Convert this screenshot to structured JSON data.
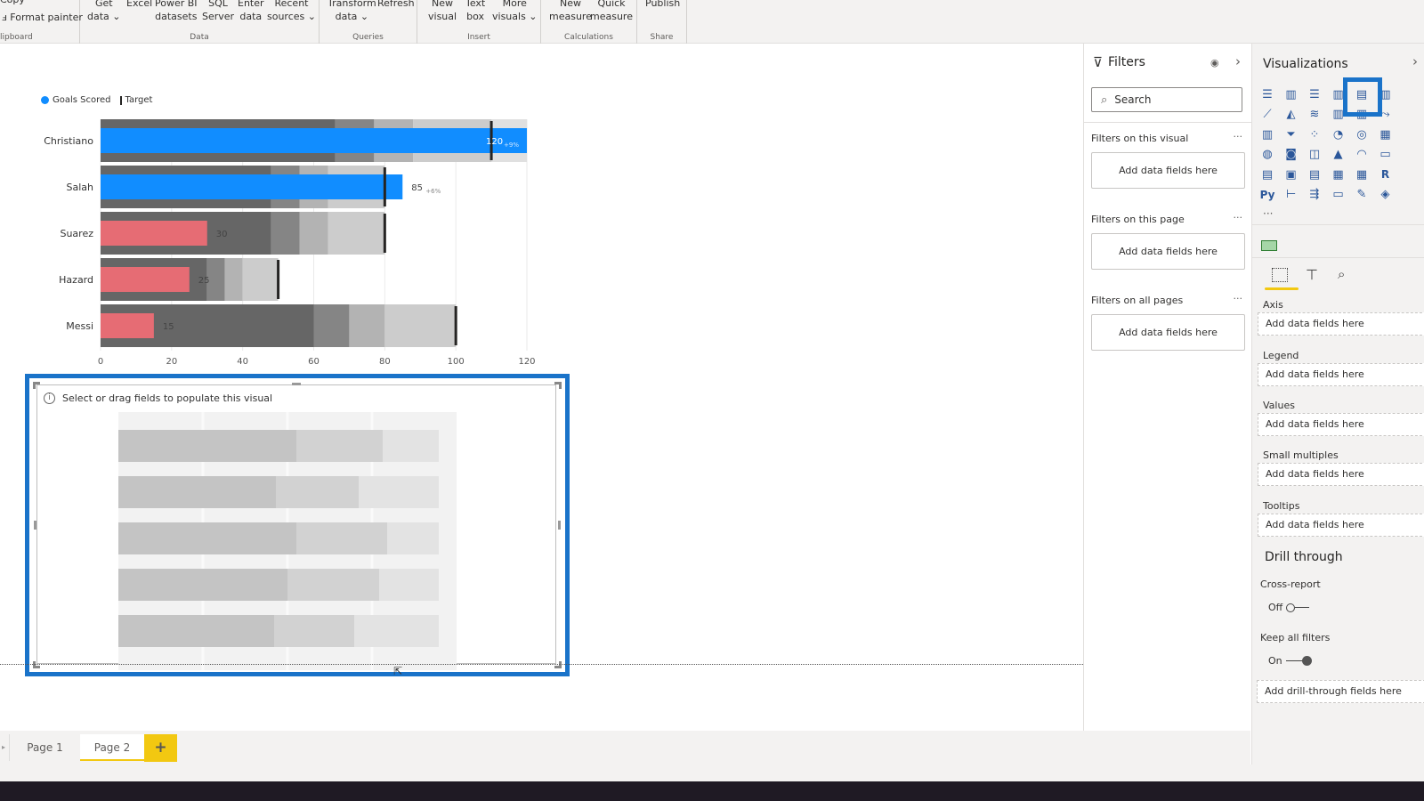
{
  "ribbon": {
    "groups": [
      {
        "name": "clipboard",
        "label": "lipboard",
        "buttons": [
          {
            "label": "Copy"
          },
          {
            "label": "Format painter"
          }
        ]
      },
      {
        "name": "data",
        "label": "Data",
        "buttons": [
          {
            "line1": "Get",
            "line2": "data ⌄"
          },
          {
            "line1": "Excel",
            "line2": ""
          },
          {
            "line1": "Power BI",
            "line2": "datasets"
          },
          {
            "line1": "SQL",
            "line2": "Server"
          },
          {
            "line1": "Enter",
            "line2": "data"
          },
          {
            "line1": "Recent",
            "line2": "sources ⌄"
          }
        ]
      },
      {
        "name": "queries",
        "label": "Queries",
        "buttons": [
          {
            "line1": "Transform",
            "line2": "data ⌄"
          },
          {
            "line1": "Refresh",
            "line2": ""
          }
        ]
      },
      {
        "name": "insert",
        "label": "Insert",
        "buttons": [
          {
            "line1": "New",
            "line2": "visual"
          },
          {
            "line1": "Text",
            "line2": "box"
          },
          {
            "line1": "More",
            "line2": "visuals ⌄"
          }
        ]
      },
      {
        "name": "calculations",
        "label": "Calculations",
        "buttons": [
          {
            "line1": "New",
            "line2": "measure"
          },
          {
            "line1": "Quick",
            "line2": "measure"
          }
        ]
      },
      {
        "name": "share",
        "label": "Share",
        "buttons": [
          {
            "line1": "Publish",
            "line2": ""
          }
        ]
      }
    ]
  },
  "chart_data": {
    "type": "bullet",
    "legend": [
      {
        "label": "Goals Scored",
        "color": "#118dff"
      },
      {
        "label": "Target",
        "color": "#252423"
      }
    ],
    "legend_position": "top-left",
    "xlim": [
      0,
      120
    ],
    "x_ticks": [
      0,
      20,
      40,
      60,
      80,
      100,
      120
    ],
    "categories": [
      "Christiano",
      "Salah",
      "Suarez",
      "Hazard",
      "Messi"
    ],
    "values": [
      120,
      85,
      30,
      25,
      15
    ],
    "targets": [
      110,
      80,
      80,
      50,
      100
    ],
    "bands": [
      [
        66,
        77,
        88,
        120
      ],
      [
        48,
        56,
        64,
        80
      ],
      [
        48,
        56,
        64,
        80
      ],
      [
        30,
        35,
        40,
        50
      ],
      [
        60,
        70,
        80,
        100
      ]
    ],
    "value_labels": [
      "120",
      "85",
      "30",
      "25",
      "15"
    ],
    "variance_labels": [
      "+9%",
      "+6%",
      "",
      "",
      ""
    ],
    "bar_colors": [
      "#118dff",
      "#118dff",
      "#e66c74",
      "#e66c74",
      "#e66c74"
    ]
  },
  "empty_visual": {
    "message": "Select or drag fields to populate this visual"
  },
  "filters": {
    "title": "Filters",
    "search_placeholder": "Search",
    "sections": [
      {
        "title": "Filters on this visual",
        "well": "Add data fields here"
      },
      {
        "title": "Filters on this page",
        "well": "Add data fields here"
      },
      {
        "title": "Filters on all pages",
        "well": "Add data fields here"
      }
    ]
  },
  "visualizations": {
    "title": "Visualizations",
    "field_wells": [
      {
        "label": "Axis",
        "well": "Add data fields here"
      },
      {
        "label": "Legend",
        "well": "Add data fields here"
      },
      {
        "label": "Values",
        "well": "Add data fields here"
      },
      {
        "label": "Small multiples",
        "well": "Add data fields here"
      },
      {
        "label": "Tooltips",
        "well": "Add data fields here"
      }
    ],
    "drill_through": {
      "title": "Drill through",
      "cross_report_label": "Cross-report",
      "cross_report_state": "Off",
      "keep_filters_label": "Keep all filters",
      "keep_filters_state": "On",
      "well": "Add drill-through fields here"
    },
    "accent_color": "#1a73c9"
  },
  "pages": {
    "tabs": [
      {
        "label": "Page 1",
        "active": false
      },
      {
        "label": "Page 2",
        "active": true
      }
    ],
    "add_label": "+",
    "add_color": "#f2c811"
  }
}
